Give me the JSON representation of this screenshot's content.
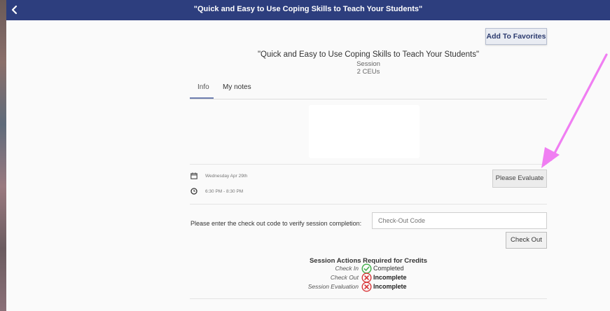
{
  "topbar": {
    "title": "\"Quick and Easy to Use Coping Skills to Teach Your Students\"",
    "back_icon": "chevron-left-icon"
  },
  "favorites": {
    "label": "Add To Favorites"
  },
  "session": {
    "title": "\"Quick and Easy to Use Coping Skills to Teach Your Students\"",
    "type": "Session",
    "credits": "2 CEUs"
  },
  "tabs": [
    {
      "label": "Info",
      "active": true
    },
    {
      "label": "My notes",
      "active": false
    }
  ],
  "details": {
    "date": "Wednesday Apr 29th",
    "time": "6:30 PM - 8:30 PM",
    "date_icon": "calendar-icon",
    "time_icon": "clock-icon"
  },
  "evaluate": {
    "label": "Please Evaluate"
  },
  "checkout": {
    "prompt": "Please enter the check out code to verify session completion:",
    "placeholder": "Check-Out Code",
    "value": "",
    "button_label": "Check Out"
  },
  "requirements": {
    "title": "Session Actions Required for Credits",
    "items": [
      {
        "label": "Check In",
        "status": "Completed",
        "icon": "check-circle-icon",
        "color": "#3fae49"
      },
      {
        "label": "Check Out",
        "status": "Incomplete",
        "icon": "x-circle-icon",
        "color": "#d9383a"
      },
      {
        "label": "Session Evaluation",
        "status": "Incomplete",
        "icon": "x-circle-icon",
        "color": "#d9383a"
      }
    ]
  },
  "colors": {
    "header": "#2d3e7e",
    "accent": "#6e7fb0",
    "annotation_arrow": "#f07ef2"
  }
}
